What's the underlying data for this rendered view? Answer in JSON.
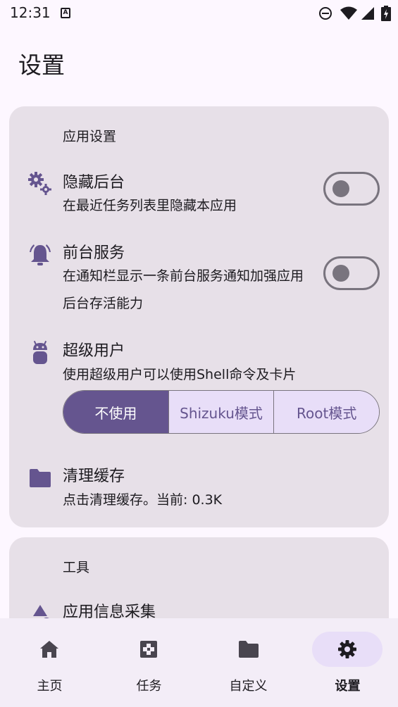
{
  "status": {
    "time": "12:31",
    "notification_icon": "A"
  },
  "page": {
    "title": "设置"
  },
  "app_settings": {
    "section_title": "应用设置",
    "hide_background": {
      "icon": "gears-icon",
      "title": "隐藏后台",
      "desc": "在最近任务列表里隐藏本应用",
      "enabled": false
    },
    "foreground_service": {
      "icon": "bell-ring-icon",
      "title": "前台服务",
      "desc": "在通知栏显示一条前台服务通知加强应用后台存活能力",
      "enabled": false
    },
    "superuser": {
      "icon": "android-icon",
      "title": "超级用户",
      "desc": "使用超级用户可以使用Shell命令及卡片",
      "options": [
        "不使用",
        "Shizuku模式",
        "Root模式"
      ],
      "selected": "不使用"
    },
    "clear_cache": {
      "icon": "folder-icon",
      "title": "清理缓存",
      "desc": "点击清理缓存。当前: 0.3K"
    }
  },
  "tools": {
    "section_title": "工具",
    "app_info": {
      "icon": "shapes-icon",
      "title": "应用信息采集"
    }
  },
  "nav": {
    "items": [
      {
        "label": "主页",
        "icon": "home-icon"
      },
      {
        "label": "任务",
        "icon": "task-icon"
      },
      {
        "label": "自定义",
        "icon": "folder-icon"
      },
      {
        "label": "设置",
        "icon": "gear-icon"
      }
    ],
    "active": "设置"
  },
  "colors": {
    "accent": "#65558f",
    "card": "#e7e0e8",
    "background": "#fdf7ff",
    "nav_background": "#f3edf7"
  }
}
